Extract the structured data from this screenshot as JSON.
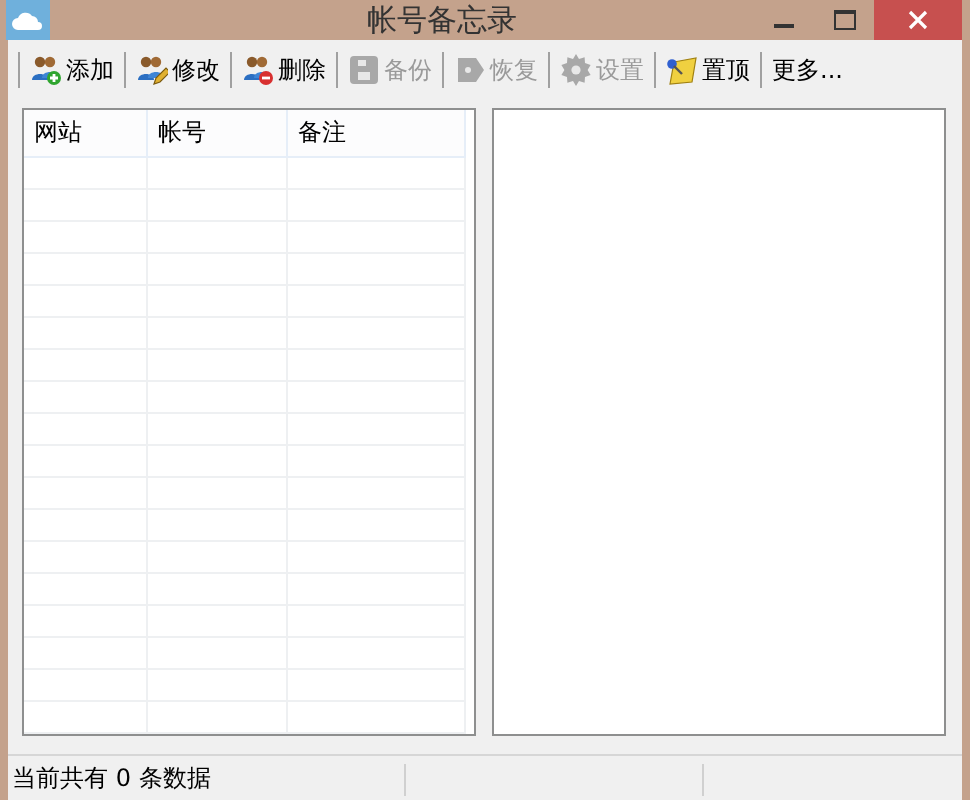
{
  "window": {
    "title": "帐号备忘录"
  },
  "toolbar": [
    {
      "kind": "add",
      "label": "添加",
      "disabled": false
    },
    {
      "kind": "edit",
      "label": "修改",
      "disabled": false
    },
    {
      "kind": "delete",
      "label": "删除",
      "disabled": false
    },
    {
      "kind": "backup",
      "label": "备份",
      "disabled": true
    },
    {
      "kind": "restore",
      "label": "恢复",
      "disabled": true
    },
    {
      "kind": "settings",
      "label": "设置",
      "disabled": true
    },
    {
      "kind": "pin",
      "label": "置顶",
      "disabled": false
    },
    {
      "kind": "text",
      "label": "更多...",
      "disabled": false
    }
  ],
  "table": {
    "columns": [
      "网站",
      "帐号",
      "备注"
    ]
  },
  "status_bar": {
    "text": "当前共有 0 条数据"
  }
}
